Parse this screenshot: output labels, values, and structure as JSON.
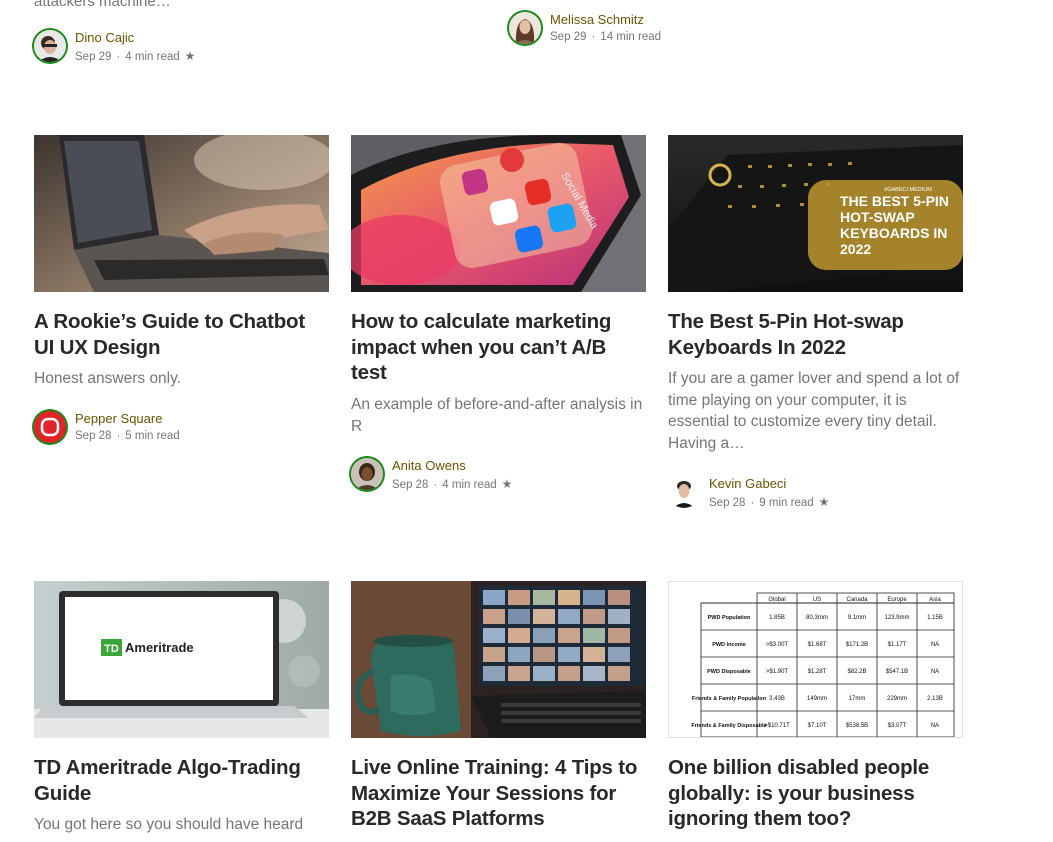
{
  "top": {
    "snippet_fragment": "attackers machine…",
    "left_author": {
      "name": "Dino Cajic",
      "date": "Sep 29",
      "read": "4 min read",
      "star": "★"
    },
    "right_author": {
      "name": "Melissa Schmitz",
      "date": "Sep 29",
      "read": "14 min read"
    }
  },
  "sep": "·",
  "row1": [
    {
      "title": "A Rookie’s Guide to Chatbot UI UX Design",
      "subtitle": "Honest answers only.",
      "author": "Pepper Square",
      "date": "Sep 28",
      "read": "5 min read"
    },
    {
      "title": "How to calculate marketing impact when you can’t A/B test",
      "subtitle": "An example of before-and-after analysis in R",
      "author": "Anita Owens",
      "date": "Sep 28",
      "read": "4 min read",
      "star": "★",
      "image_text": "Social Media"
    },
    {
      "title": "The Best 5-Pin Hot-swap Keyboards In 2022",
      "subtitle": "If you are a gamer lover and spend a lot of time playing on your computer, it is essential to customize every tiny detail. Having a…",
      "author": "Kevin Gabeci",
      "date": "Sep 28",
      "read": "9 min read",
      "star": "★",
      "image_text": {
        "small": "#GABECI MEDIUM",
        "headline": [
          "THE BEST 5-PIN",
          "HOT-SWAP",
          "KEYBOARDS IN",
          "2022"
        ]
      }
    }
  ],
  "row2": [
    {
      "title": "TD Ameritrade Algo-Trading Guide",
      "subtitle": "You got here so you should have heard",
      "image_text": {
        "logo_mark": "TD",
        "logo_word": "Ameritrade"
      }
    },
    {
      "title": "Live Online Training: 4 Tips to Maximize Your Sessions for B2B SaaS Platforms"
    },
    {
      "title": "One billion disabled people globally: is your business ignoring them too?",
      "table": {
        "headers": [
          "",
          "Global",
          "US",
          "Canada",
          "Europe",
          "Asia"
        ],
        "rows": [
          [
            "PWD Population",
            "1.85B",
            "80.3mm",
            "9.1mm",
            "123.9mm",
            "1.15B"
          ],
          [
            "PWD Income",
            ">$3.00T",
            "$1.68T",
            "$171.2B",
            "$1.17T",
            "NA"
          ],
          [
            "PWD Disposable",
            ">$1.90T",
            "$1.28T",
            "$82.2B",
            "$547.1B",
            "NA"
          ],
          [
            "Friends & Family Population",
            "3.43B",
            "149mm",
            "17mm",
            "229mm",
            "2.13B"
          ],
          [
            "Friends & Family Disposable",
            ">$10.71T",
            "$7.10T",
            "$538.5B",
            "$3.07T",
            "NA"
          ]
        ]
      }
    }
  ],
  "colors": {
    "follow_ring": "#1a8917",
    "author": "#6b5300",
    "muted": "#757575",
    "title": "#292929"
  }
}
